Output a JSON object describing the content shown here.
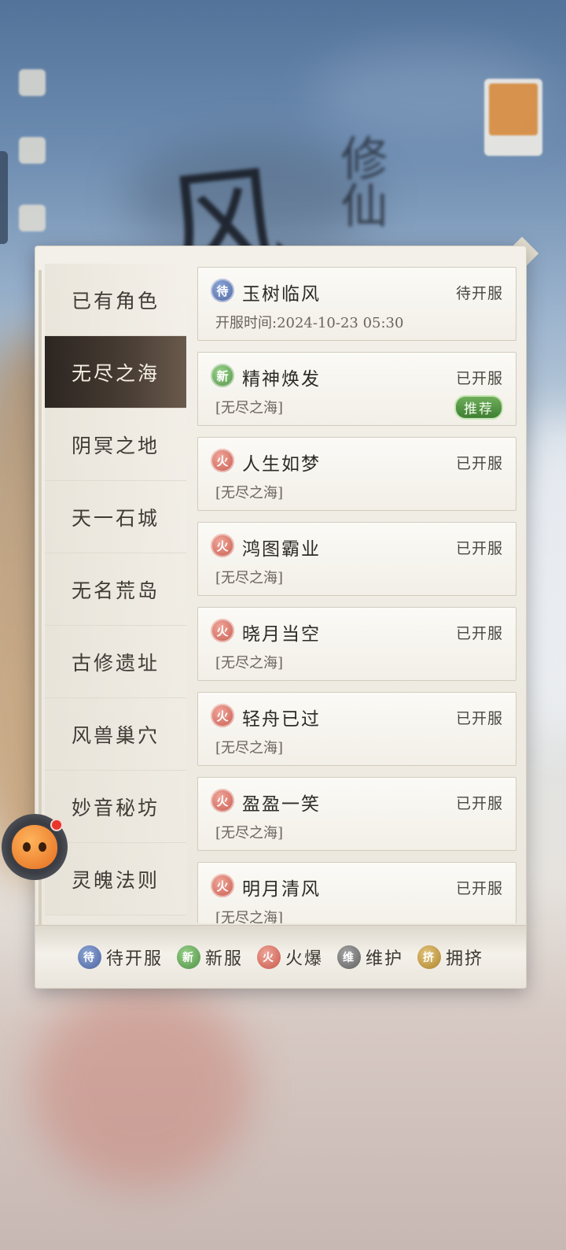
{
  "tabs": [
    {
      "label": "已有角色",
      "active": false
    },
    {
      "label": "无尽之海",
      "active": true
    },
    {
      "label": "阴冥之地",
      "active": false
    },
    {
      "label": "天一石城",
      "active": false
    },
    {
      "label": "无名荒岛",
      "active": false
    },
    {
      "label": "古修遗址",
      "active": false
    },
    {
      "label": "风兽巢穴",
      "active": false
    },
    {
      "label": "妙音秘坊",
      "active": false
    },
    {
      "label": "灵魄法则",
      "active": false
    }
  ],
  "servers": [
    {
      "badge": "待",
      "badge_type": "wait",
      "name": "玉树临风",
      "status": "待开服",
      "sub": "开服时间:2024-10-23 05:30"
    },
    {
      "badge": "新",
      "badge_type": "new",
      "name": "精神焕发",
      "status": "已开服",
      "sub": "[无尽之海]",
      "recommend": "推荐"
    },
    {
      "badge": "火",
      "badge_type": "hot",
      "name": "人生如梦",
      "status": "已开服",
      "sub": "[无尽之海]"
    },
    {
      "badge": "火",
      "badge_type": "hot",
      "name": "鸿图霸业",
      "status": "已开服",
      "sub": "[无尽之海]"
    },
    {
      "badge": "火",
      "badge_type": "hot",
      "name": "晓月当空",
      "status": "已开服",
      "sub": "[无尽之海]"
    },
    {
      "badge": "火",
      "badge_type": "hot",
      "name": "轻舟已过",
      "status": "已开服",
      "sub": "[无尽之海]"
    },
    {
      "badge": "火",
      "badge_type": "hot",
      "name": "盈盈一笑",
      "status": "已开服",
      "sub": "[无尽之海]"
    },
    {
      "badge": "火",
      "badge_type": "hot",
      "name": "明月清风",
      "status": "已开服",
      "sub": "[无尽之海]"
    }
  ],
  "legend": [
    {
      "badge": "待",
      "badge_type": "wait",
      "label": "待开服"
    },
    {
      "badge": "新",
      "badge_type": "new",
      "label": "新服"
    },
    {
      "badge": "火",
      "badge_type": "hot",
      "label": "火爆"
    },
    {
      "badge": "维",
      "badge_type": "maint",
      "label": "维护"
    },
    {
      "badge": "挤",
      "badge_type": "busy",
      "label": "拥挤"
    }
  ],
  "icons": {
    "mascot": "orange-mascot-icon",
    "notification_dot": "red-dot-icon"
  }
}
